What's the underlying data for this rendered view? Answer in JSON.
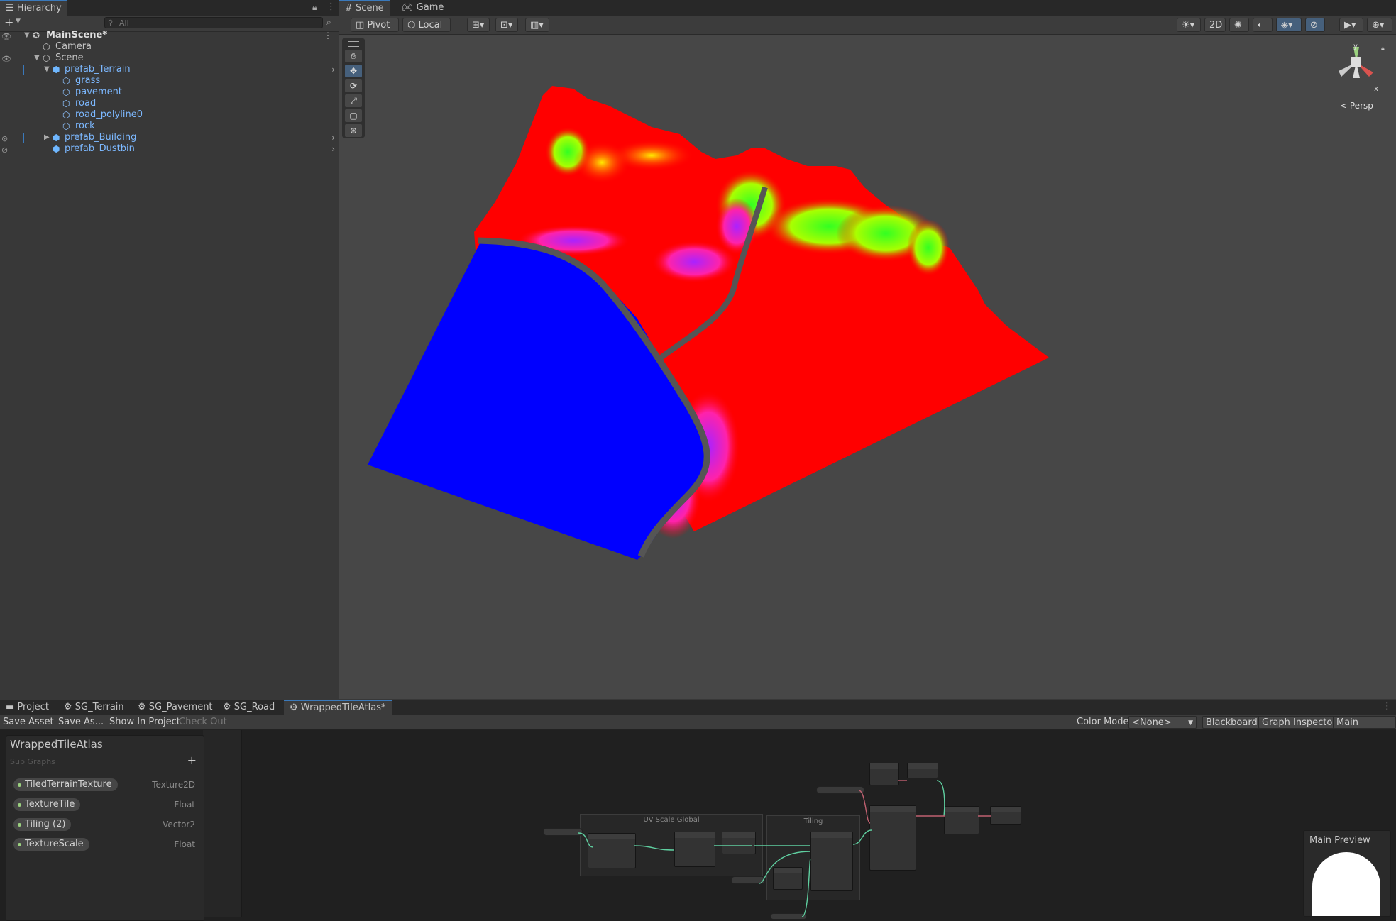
{
  "hierarchy": {
    "tab": "Hierarchy",
    "search_placeholder": "All",
    "items": [
      {
        "label": "MainScene*"
      },
      {
        "label": "Camera"
      },
      {
        "label": "Scene"
      },
      {
        "label": "prefab_Terrain"
      },
      {
        "label": "grass"
      },
      {
        "label": "pavement"
      },
      {
        "label": "road"
      },
      {
        "label": "road_polyline0"
      },
      {
        "label": "rock"
      },
      {
        "label": "prefab_Building"
      },
      {
        "label": "prefab_Dustbin"
      }
    ]
  },
  "scene": {
    "tabs": [
      "Scene",
      "Game"
    ],
    "toolbar": {
      "pivot": "Pivot",
      "local": "Local",
      "mode_2d": "2D"
    },
    "gizmo": {
      "y": "y",
      "x": "x",
      "persp": "Persp"
    }
  },
  "bottom": {
    "tabs": [
      "Project",
      "SG_Terrain",
      "SG_Pavement",
      "SG_Road",
      "WrappedTileAtlas*"
    ],
    "toolbar": {
      "save_asset": "Save Asset",
      "save_as": "Save As...",
      "show_in_project": "Show In Project",
      "check_out": "Check Out",
      "color_mode_label": "Color Mode",
      "color_mode_value": "<None>",
      "blackboard": "Blackboard",
      "graph_inspector": "Graph Inspector",
      "main_preview": "Main Preview"
    },
    "blackboard": {
      "title": "WrappedTileAtlas",
      "subtitle": "Sub Graphs",
      "properties": [
        {
          "name": "TiledTerrainTexture",
          "type": "Texture2D"
        },
        {
          "name": "TextureTile",
          "type": "Float"
        },
        {
          "name": "Tiling (2)",
          "type": "Vector2"
        },
        {
          "name": "TextureScale",
          "type": "Float"
        }
      ]
    },
    "graph": {
      "groups": {
        "uv": "UV Scale Global",
        "tiling": "Tiling"
      },
      "preview_title": "Main Preview"
    }
  },
  "colors": {
    "accent": "#3a79bb",
    "terrain_red": "#ff0000",
    "terrain_blue": "#0000ff",
    "terrain_green": "#22ee22"
  }
}
